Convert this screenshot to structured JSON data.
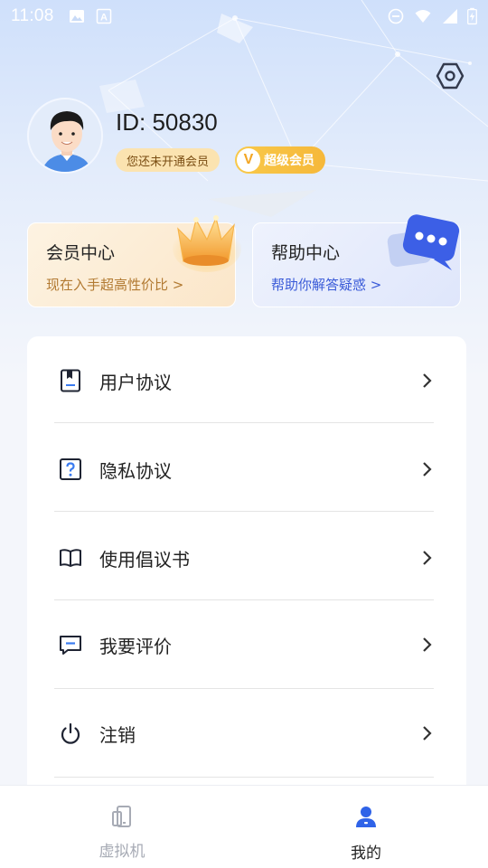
{
  "status_bar": {
    "time": "11:08",
    "left_icons": [
      "image-icon",
      "font-icon"
    ],
    "right_icons": [
      "do-not-disturb-icon",
      "wifi-icon",
      "signal-icon",
      "battery-charging-icon"
    ]
  },
  "header": {
    "settings_icon": "hexagon-settings-icon"
  },
  "profile": {
    "user_id": "ID: 50830",
    "vip_status": "您还未开通会员",
    "svip_badge_letter": "V",
    "svip_badge_label": "超级会员"
  },
  "cards": {
    "vip_center": {
      "title": "会员中心",
      "subtitle": "现在入手超高性价比 >"
    },
    "help_center": {
      "title": "帮助中心",
      "subtitle": "帮助你解答疑惑 >"
    }
  },
  "menu": {
    "items": [
      {
        "label": "用户协议",
        "icon": "document-icon"
      },
      {
        "label": "隐私协议",
        "icon": "question-icon"
      },
      {
        "label": "使用倡议书",
        "icon": "book-icon"
      },
      {
        "label": "我要评价",
        "icon": "comment-icon"
      },
      {
        "label": "注销",
        "icon": "power-icon"
      }
    ]
  },
  "bottom_nav": {
    "tabs": [
      {
        "label": "虚拟机",
        "icon": "phone-icon",
        "active": false
      },
      {
        "label": "我的",
        "icon": "person-icon",
        "active": true
      }
    ]
  },
  "colors": {
    "accent_blue": "#3a5bd8",
    "vip_gold": "#f6b83a",
    "inactive_gray": "#a7abb5"
  }
}
